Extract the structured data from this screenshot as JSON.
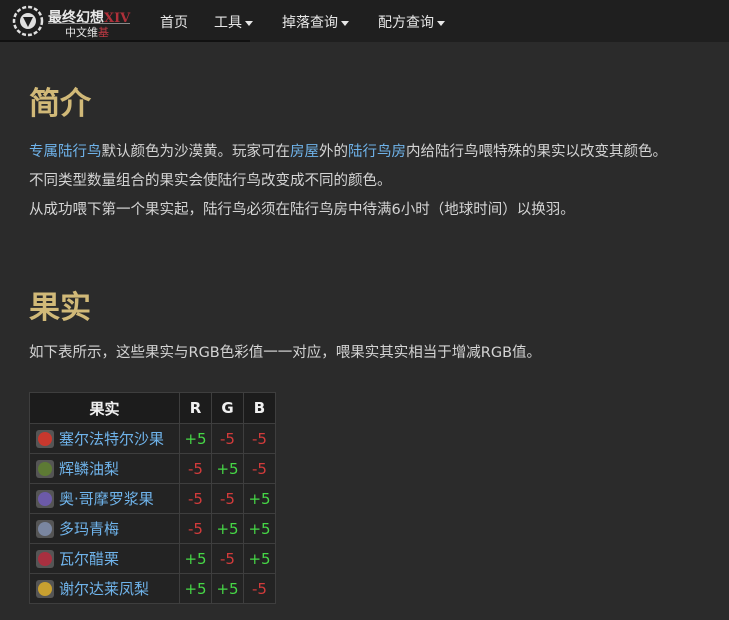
{
  "header": {
    "logo_title": "最终幻想",
    "logo_xiv": "XIV",
    "logo_sub1": "中文维",
    "logo_sub2": "基",
    "nav": [
      {
        "label": "首页"
      },
      {
        "label": "工具"
      },
      {
        "label": "掉落查询"
      },
      {
        "label": "配方查询"
      }
    ]
  },
  "intro": {
    "heading": "简介",
    "line1": {
      "link1": "专属陆行鸟",
      "t1": "默认颜色为沙漠黄。玩家可在",
      "link2": "房屋",
      "t2": "外的",
      "link3": "陆行鸟房",
      "t3": "内给陆行鸟喂特殊的果实以改变其颜色。"
    },
    "line2": "不同类型数量组合的果实会使陆行鸟改变成不同的颜色。",
    "line3": "从成功喂下第一个果实起，陆行鸟必须在陆行鸟房中待满6小时（地球时间）以换羽。"
  },
  "fruit": {
    "heading": "果实",
    "description": "如下表所示，这些果实与RGB色彩值一一对应，喂果实其实相当于增减RGB值。",
    "table": {
      "headers": [
        "果实",
        "R",
        "G",
        "B"
      ],
      "rows": [
        {
          "name": "塞尔法特尔沙果",
          "r": "+5",
          "g": "-5",
          "b": "-5",
          "icon": "red-apple-icon",
          "color": "#c8382e"
        },
        {
          "name": "辉鳞油梨",
          "r": "-5",
          "g": "+5",
          "b": "-5",
          "icon": "avocado-icon",
          "color": "#5d7a34"
        },
        {
          "name": "奥·哥摩罗浆果",
          "r": "-5",
          "g": "-5",
          "b": "+5",
          "icon": "grape-berry-icon",
          "color": "#6c5aa8"
        },
        {
          "name": "多玛青梅",
          "r": "-5",
          "g": "+5",
          "b": "+5",
          "icon": "plum-icon",
          "color": "#7a86a0"
        },
        {
          "name": "瓦尔醋栗",
          "r": "+5",
          "g": "-5",
          "b": "+5",
          "icon": "currant-icon",
          "color": "#a83040"
        },
        {
          "name": "谢尔达莱凤梨",
          "r": "+5",
          "g": "+5",
          "b": "-5",
          "icon": "pineapple-icon",
          "color": "#c8a030"
        }
      ]
    }
  }
}
